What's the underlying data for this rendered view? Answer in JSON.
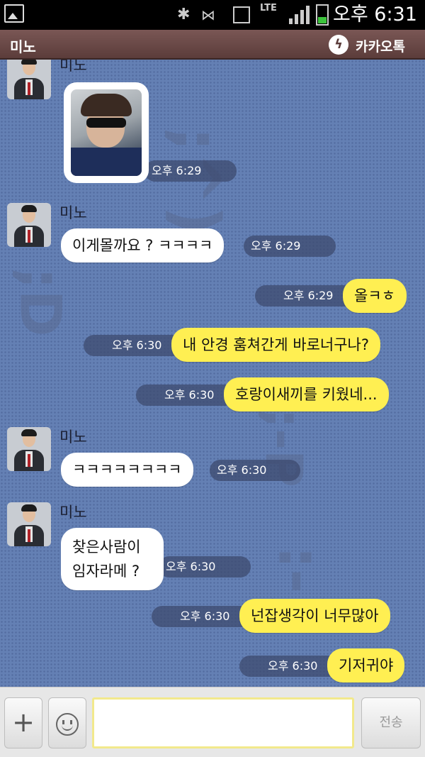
{
  "status_bar": {
    "network": "LTE",
    "time": "오후 6:31",
    "icons": [
      "gallery-icon",
      "bluetooth-icon",
      "nfc-icon",
      "picture-icon",
      "lte-icon",
      "signal-icon",
      "battery-icon"
    ]
  },
  "header": {
    "title": "미노",
    "brand": "카카오톡"
  },
  "decorations": [
    ";^)",
    ";D",
    ";-P",
    ":-)"
  ],
  "messages": [
    {
      "type": "in-photo",
      "sender": "미노",
      "time": "오후 6:29"
    },
    {
      "type": "in",
      "sender": "미노",
      "text": "이게몰까요 ? ㅋㅋㅋㅋ",
      "time": "오후 6:29"
    },
    {
      "type": "out",
      "text": "올ㅋㅎ",
      "time": "오후 6:29"
    },
    {
      "type": "out",
      "text": "내 안경 훔쳐간게 바로너구나?",
      "time": "오후 6:30"
    },
    {
      "type": "out",
      "text": "호랑이새끼를 키웠네...",
      "time": "오후 6:30"
    },
    {
      "type": "in",
      "sender": "미노",
      "text": "ㅋㅋㅋㅋㅋㅋㅋㅋ",
      "time": "오후 6:30"
    },
    {
      "type": "in",
      "sender": "미노",
      "text_lines": [
        "찾은사람이",
        "임자라메 ?"
      ],
      "time": "오후 6:30"
    },
    {
      "type": "out",
      "text": "넌잡생각이 너무많아",
      "time": "오후 6:30"
    },
    {
      "type": "out",
      "text": "기저귀야",
      "time": "오후 6:30"
    }
  ],
  "input_bar": {
    "plus_label": "+",
    "message_value": "",
    "send_label": "전송"
  },
  "colors": {
    "chat_background": "#6480b4",
    "outgoing_bubble": "#ffef52",
    "incoming_bubble": "#ffffff",
    "title_bar": "#6a4846"
  }
}
